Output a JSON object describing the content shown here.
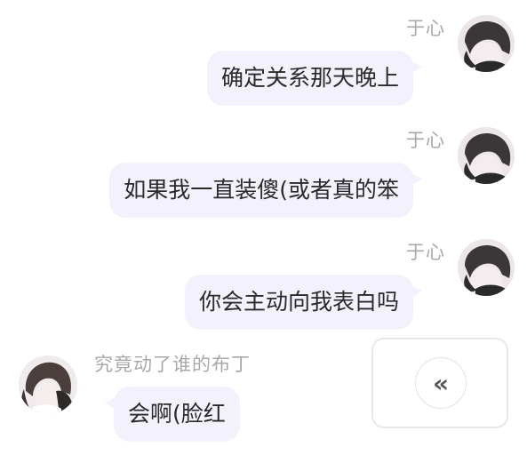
{
  "messages": [
    {
      "sender": "于心",
      "text": "确定关系那天晚上",
      "side": "right",
      "avatar": "avatar-right-user-icon"
    },
    {
      "sender": "于心",
      "text": "如果我一直装傻(或者真的笨",
      "side": "right",
      "avatar": "avatar-right-user-icon"
    },
    {
      "sender": "于心",
      "text": "你会主动向我表白吗",
      "side": "right",
      "avatar": "avatar-right-user-icon"
    },
    {
      "sender": "究竟动了谁的布丁",
      "text": "会啊(脸红",
      "side": "left",
      "avatar": "avatar-left-user-icon"
    }
  ],
  "float_button": {
    "icon": "double-chevron-left-icon",
    "glyph": "«"
  },
  "colors": {
    "bubble": "#f3f1fb",
    "name_text": "#a9a9a9",
    "message_text": "#2a2a2a"
  }
}
